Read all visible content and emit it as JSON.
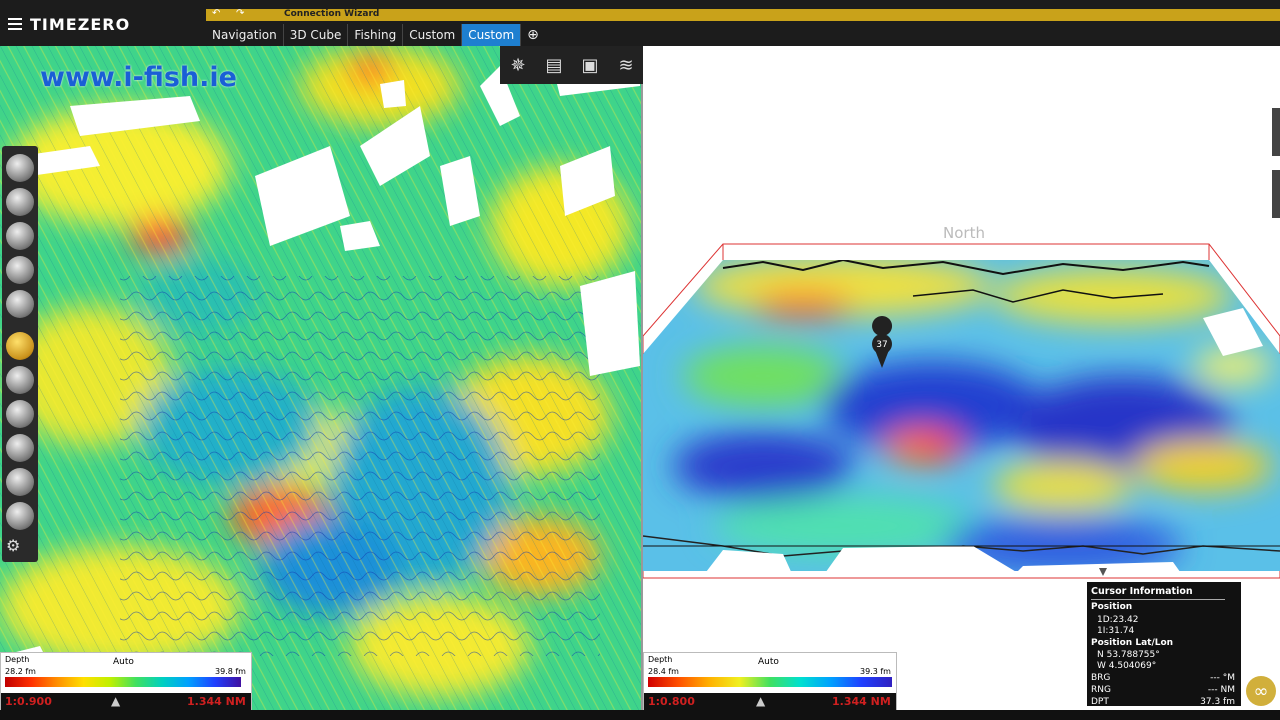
{
  "app": {
    "name": "TIMEZERO"
  },
  "wizard": {
    "title": "Connection Wizard",
    "undo": "↶",
    "redo": "↷"
  },
  "tabs": [
    {
      "label": "Navigation"
    },
    {
      "label": "3D Cube"
    },
    {
      "label": "Fishing"
    },
    {
      "label": "Custom"
    },
    {
      "label": "Custom",
      "active": true
    }
  ],
  "add_tab": "⊕",
  "watermark": "www.i-fish.ie",
  "left_legend": {
    "label": "Depth",
    "mode": "Auto",
    "min": "28.2 fm",
    "max": "39.8 fm",
    "scale_left": "1:0.900",
    "scale_right": "1.344 NM"
  },
  "right_legend": {
    "label": "Depth",
    "mode": "Auto",
    "min": "28.4 fm",
    "max": "39.3 fm",
    "scale_left": "1:0.800",
    "scale_right": "1.344 NM"
  },
  "north_label": "North",
  "marker_label": "37",
  "cursor_info": {
    "title": "Cursor Information",
    "position_label": "Position",
    "pos_x": "1D:23.42",
    "pos_y": "1I:31.74",
    "latlon_label": "Position Lat/Lon",
    "lat": "N 53.788755°",
    "lon": "W 4.504069°",
    "brg_label": "BRG",
    "brg_value": "--- °M",
    "rng_label": "RNG",
    "rng_value": "--- NM",
    "dpt_label": "DPT",
    "dpt_value": "37.3 fm"
  },
  "colors": {
    "accent": "#1e7fd0",
    "wizard_bar": "#c9a21a",
    "scale_red": "#d02020"
  }
}
